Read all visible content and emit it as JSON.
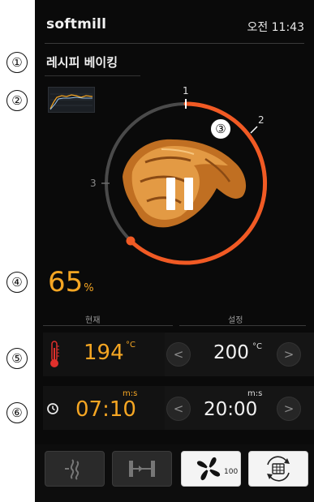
{
  "annotations": [
    "①",
    "②",
    "③",
    "④",
    "⑤",
    "⑥"
  ],
  "header": {
    "brand": "softmill",
    "time": "오전 11:43"
  },
  "mode": {
    "title": "레시피 베이킹"
  },
  "dial": {
    "steps": [
      "1",
      "2",
      "3"
    ],
    "accent_color": "#f15a24",
    "track_color": "#4a4a4a",
    "state": "paused"
  },
  "progress": {
    "value": "65",
    "unit": "%"
  },
  "labels": {
    "current": "현재",
    "setpoint": "설정"
  },
  "temperature": {
    "icon": "thermometer-icon",
    "current": "194",
    "current_unit": "°C",
    "set": "200",
    "set_unit": "°C",
    "dec_label": "<",
    "inc_label": ">"
  },
  "timer": {
    "icon": "clock-icon",
    "current": "07:10",
    "current_unit": "m:s",
    "set": "20:00",
    "set_unit": "m:s",
    "dec_label": "<",
    "inc_label": ">"
  },
  "toolbar": {
    "fan_speed": "100"
  }
}
